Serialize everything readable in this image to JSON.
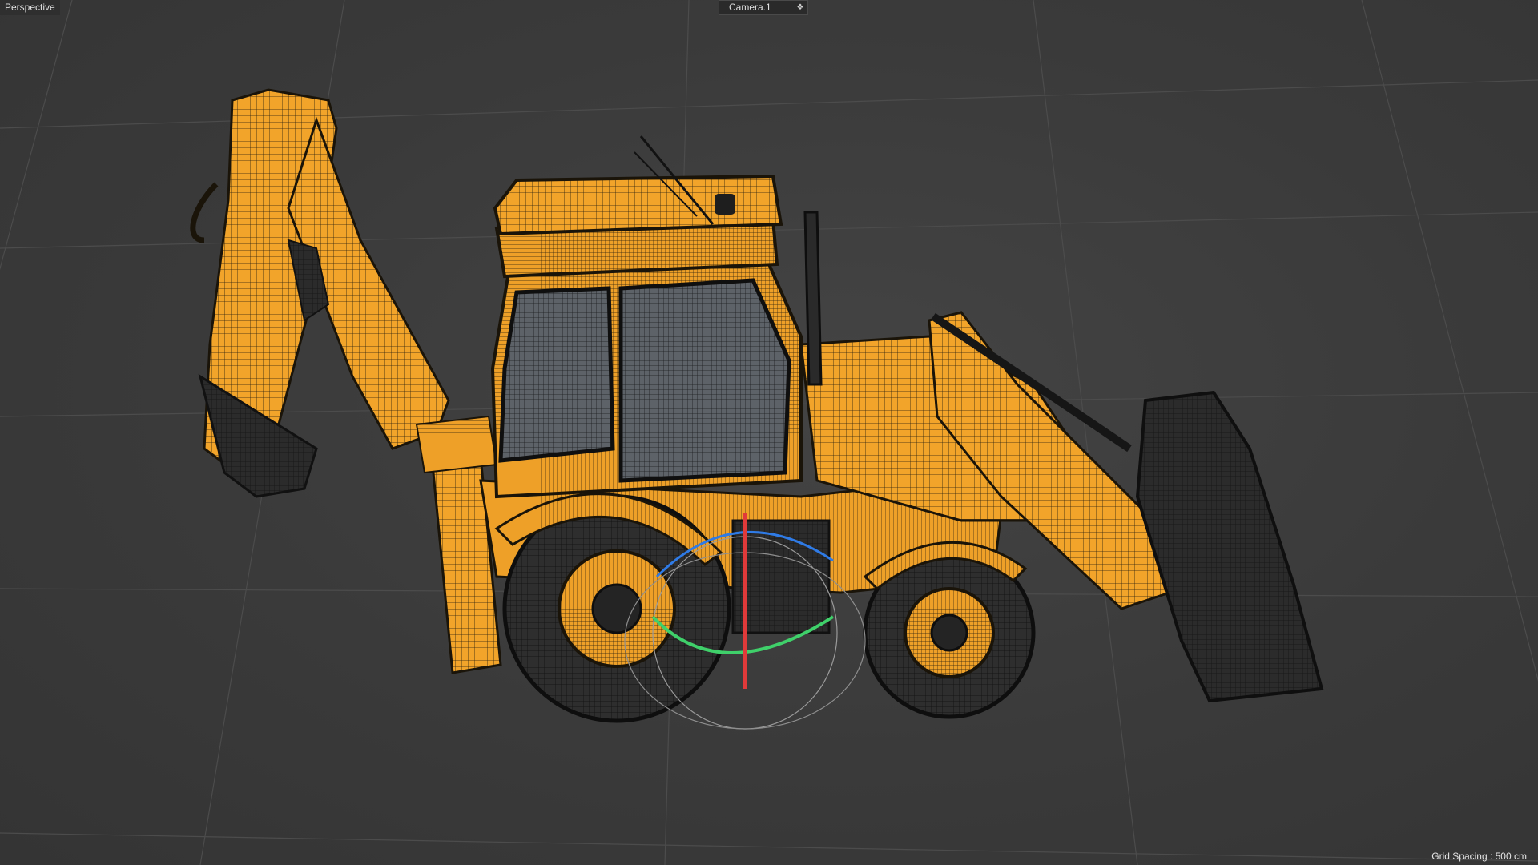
{
  "viewport": {
    "view_name": "Perspective",
    "camera": "Camera.1",
    "camera_icon": "camera-toggle-icon",
    "grid_spacing": "Grid Spacing : 500 cm"
  },
  "scene": {
    "object": "backhoe-loader-wireframe-model",
    "gizmo": "rotation-gizmo",
    "colors": {
      "background": "#3b3b3b",
      "body_yellow": "#f2a42a",
      "wire": "#1e1a12",
      "dark_parts": "#2a2a2a",
      "axis_x": "#e03a3a",
      "axis_y": "#3fd06a",
      "axis_z": "#2f7be6"
    }
  }
}
